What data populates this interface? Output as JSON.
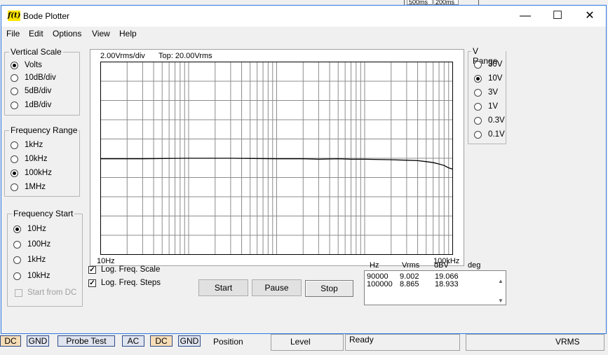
{
  "background": {
    "top_buttons": [
      "500ms",
      "200ms"
    ],
    "bottom_buttons": [
      "DC",
      "GND",
      "Probe Test",
      "AC",
      "DC",
      "GND"
    ],
    "bottom_labels": {
      "position": "Position",
      "level": "Level",
      "ready": "Ready",
      "vrms": "VRMS"
    }
  },
  "window": {
    "title": "Bode Plotter",
    "icon_text": "f(t)",
    "controls": {
      "minimize": "—",
      "maximize": "☐",
      "close": "✕"
    }
  },
  "menu": [
    "File",
    "Edit",
    "Options",
    "View",
    "Help"
  ],
  "vertical_scale": {
    "title": "Vertical Scale",
    "options": [
      {
        "label": "Volts",
        "selected": true
      },
      {
        "label": "10dB/div",
        "selected": false
      },
      {
        "label": "5dB/div",
        "selected": false
      },
      {
        "label": "1dB/div",
        "selected": false
      }
    ]
  },
  "frequency_range": {
    "title": "Frequency Range",
    "options": [
      {
        "label": "1kHz",
        "selected": false
      },
      {
        "label": "10kHz",
        "selected": false
      },
      {
        "label": "100kHz",
        "selected": true
      },
      {
        "label": "1MHz",
        "selected": false
      }
    ]
  },
  "frequency_start": {
    "title": "Frequency Start",
    "options": [
      {
        "label": "10Hz",
        "selected": true
      },
      {
        "label": "100Hz",
        "selected": false
      },
      {
        "label": "1kHz",
        "selected": false
      },
      {
        "label": "10kHz",
        "selected": false
      }
    ],
    "start_from_dc": {
      "label": "Start from DC",
      "checked": false,
      "enabled": false
    }
  },
  "v_range": {
    "title": "V Range",
    "options": [
      {
        "label": "30V",
        "selected": false
      },
      {
        "label": "10V",
        "selected": true
      },
      {
        "label": "3V",
        "selected": false
      },
      {
        "label": "1V",
        "selected": false
      },
      {
        "label": "0.3V",
        "selected": false
      },
      {
        "label": "0.1V",
        "selected": false
      }
    ]
  },
  "plot": {
    "scale_text": "2.00Vrms/div",
    "top_text": "Top: 20.00Vrms",
    "x_min_label": "10Hz",
    "x_max_label": "100kHz"
  },
  "options": {
    "log_freq_scale": {
      "label": "Log. Freq. Scale",
      "checked": true
    },
    "log_freq_steps": {
      "label": "Log. Freq. Steps",
      "checked": true
    }
  },
  "buttons": {
    "start": "Start",
    "pause": "Pause",
    "stop": "Stop"
  },
  "readout": {
    "headers": [
      "Hz",
      "Vrms",
      "dBV",
      "deg"
    ],
    "rows": [
      [
        "90000",
        "9.002",
        "19.066",
        ""
      ],
      [
        "100000",
        "8.865",
        "18.933",
        ""
      ]
    ]
  },
  "chart_data": {
    "type": "line",
    "x_scale": "log",
    "xlim": [
      10,
      100000
    ],
    "ylim": [
      0,
      20
    ],
    "ylabel": "",
    "xlabel": "",
    "grid": true,
    "series": [
      {
        "x": [
          10,
          30,
          100,
          300,
          1000,
          2000,
          3000,
          5000,
          7000,
          10000,
          20000,
          30000,
          40000,
          50000,
          60000,
          70000,
          80000,
          90000,
          100000
        ],
        "y": [
          9.95,
          9.95,
          10.0,
          10.0,
          9.95,
          9.95,
          9.9,
          9.95,
          9.9,
          9.9,
          9.85,
          9.8,
          9.75,
          9.65,
          9.55,
          9.4,
          9.25,
          9.0,
          8.87
        ]
      }
    ],
    "color": "#000000"
  }
}
